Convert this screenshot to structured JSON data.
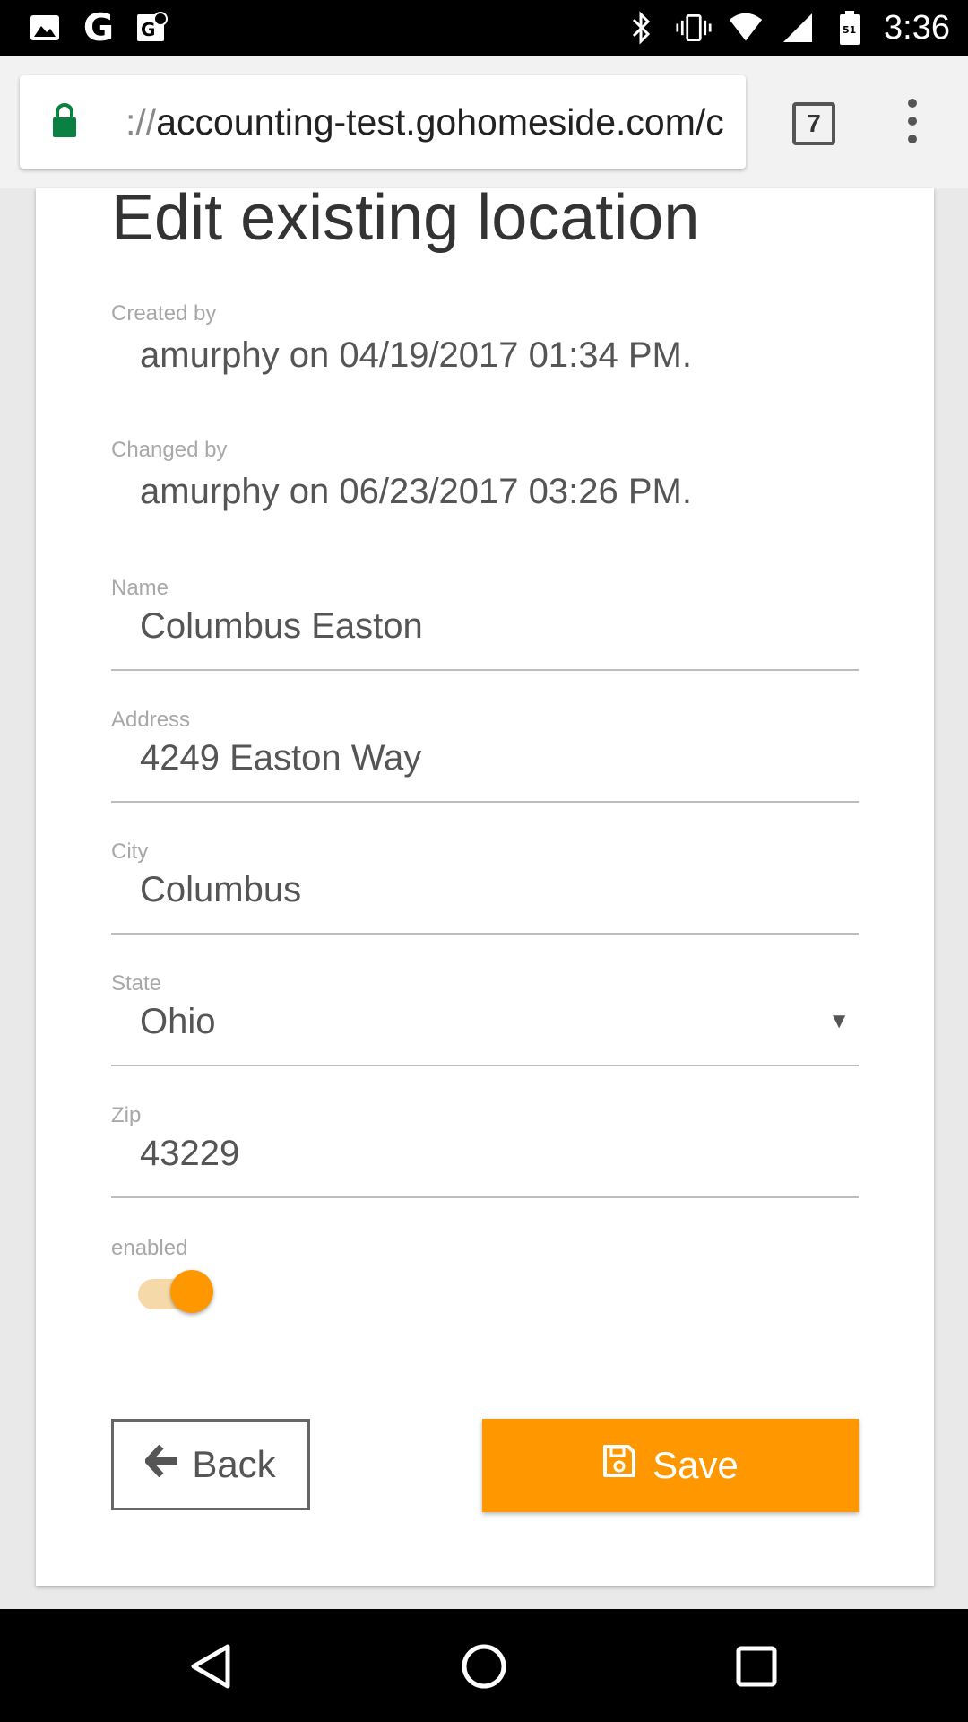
{
  "status_bar": {
    "time": "3:36",
    "left_icons": [
      "image-icon",
      "google-icon",
      "maps-icon"
    ],
    "right_icons": [
      "bluetooth-icon",
      "vibrate-icon",
      "wifi-icon",
      "signal-icon",
      "battery-icon"
    ]
  },
  "browser": {
    "url_scheme": "://",
    "url_host": "accounting-test.gohomeside.com/c",
    "tab_count": "7",
    "lock_color": "#0b8043"
  },
  "page": {
    "title": "Edit existing location",
    "created_label": "Created by",
    "created_value": "amurphy on 04/19/2017 01:34 PM.",
    "changed_label": "Changed by",
    "changed_value": "amurphy on 06/23/2017 03:26 PM."
  },
  "form": {
    "name": {
      "label": "Name",
      "value": "Columbus Easton"
    },
    "address": {
      "label": "Address",
      "value": "4249 Easton Way"
    },
    "city": {
      "label": "City",
      "value": "Columbus"
    },
    "state": {
      "label": "State",
      "value": "Ohio"
    },
    "zip": {
      "label": "Zip",
      "value": "43229"
    },
    "enabled": {
      "label": "enabled",
      "checked": true
    }
  },
  "actions": {
    "back_label": "Back",
    "save_label": "Save",
    "accent_color": "#ff9800"
  },
  "nav": {
    "icons": [
      "back-triangle-icon",
      "home-circle-icon",
      "recents-square-icon"
    ]
  }
}
